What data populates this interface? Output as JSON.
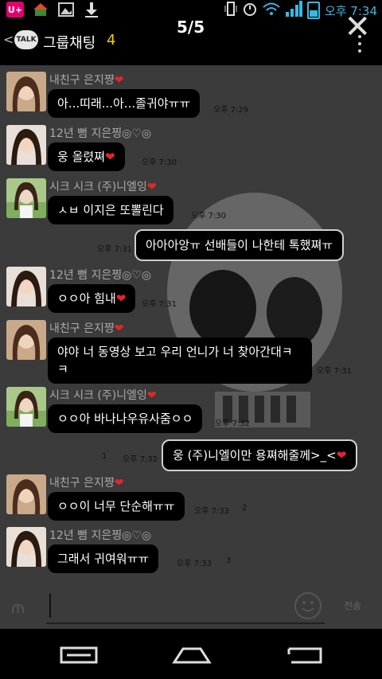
{
  "status_bar": {
    "carrier": "U+",
    "time": "오후 7:34"
  },
  "header": {
    "back": "<",
    "logo": "TALK",
    "title": "그룹채팅",
    "member_count": "4",
    "page_counter": "5/5",
    "close": "✕"
  },
  "messages": [
    {
      "sender": "내친구 은지쨩",
      "hearts": "❤",
      "text": "아...띠래...아...졸귀야ㅠㅠ",
      "time": "오후 7:29"
    },
    {
      "sender": "12년 뻠 지은찡◎♡◎",
      "hearts": "",
      "text": "웅 올렸쪄",
      "text_heart": "❤",
      "time": "오후 7:30"
    },
    {
      "sender": "시크 시크 (주)니엘잉",
      "hearts": "❤",
      "text": "ㅅㅂ 이지은 또뽈린다",
      "time": "오후 7:30"
    },
    {
      "text": "아아아앙ㅠ 선배들이 나한테 톡했쪄ㅠ",
      "time": "오후 7:31"
    },
    {
      "sender": "12년 뻠 지은찡◎♡◎",
      "hearts": "",
      "text": "ㅇㅇ아 힘내",
      "text_heart": "❤",
      "time": "오후 7:31"
    },
    {
      "sender": "내친구 은지쨩",
      "hearts": "❤",
      "text": "야야 너 동영상 보고 우리 언니가 너 찾아간대ㅋㅋ",
      "time": "오후 7:31"
    },
    {
      "sender": "시크 시크 (주)니엘잉",
      "hearts": "❤",
      "text": "ㅇㅇ아 바나나우유사줌ㅇㅇ",
      "time": "오후 7:32"
    },
    {
      "text": "웅 (주)니엘이만 용쪄해줄께>_<",
      "text_heart": "❤",
      "time": "오후 7:32",
      "unread": "1"
    },
    {
      "sender": "내친구 은지쨩",
      "hearts": "❤",
      "text": "ㅇㅇ이 너무 단순해ㅠㅠ",
      "time": "오후 7:33",
      "unread": "2"
    },
    {
      "sender": "12년 뻠 지은찡◎♡◎",
      "hearts": "",
      "text": "그래서 귀여워ㅠㅠ",
      "time": "오후 7:33",
      "unread": "3"
    }
  ],
  "input": {
    "attach": "⫙",
    "send_label": "전송"
  }
}
